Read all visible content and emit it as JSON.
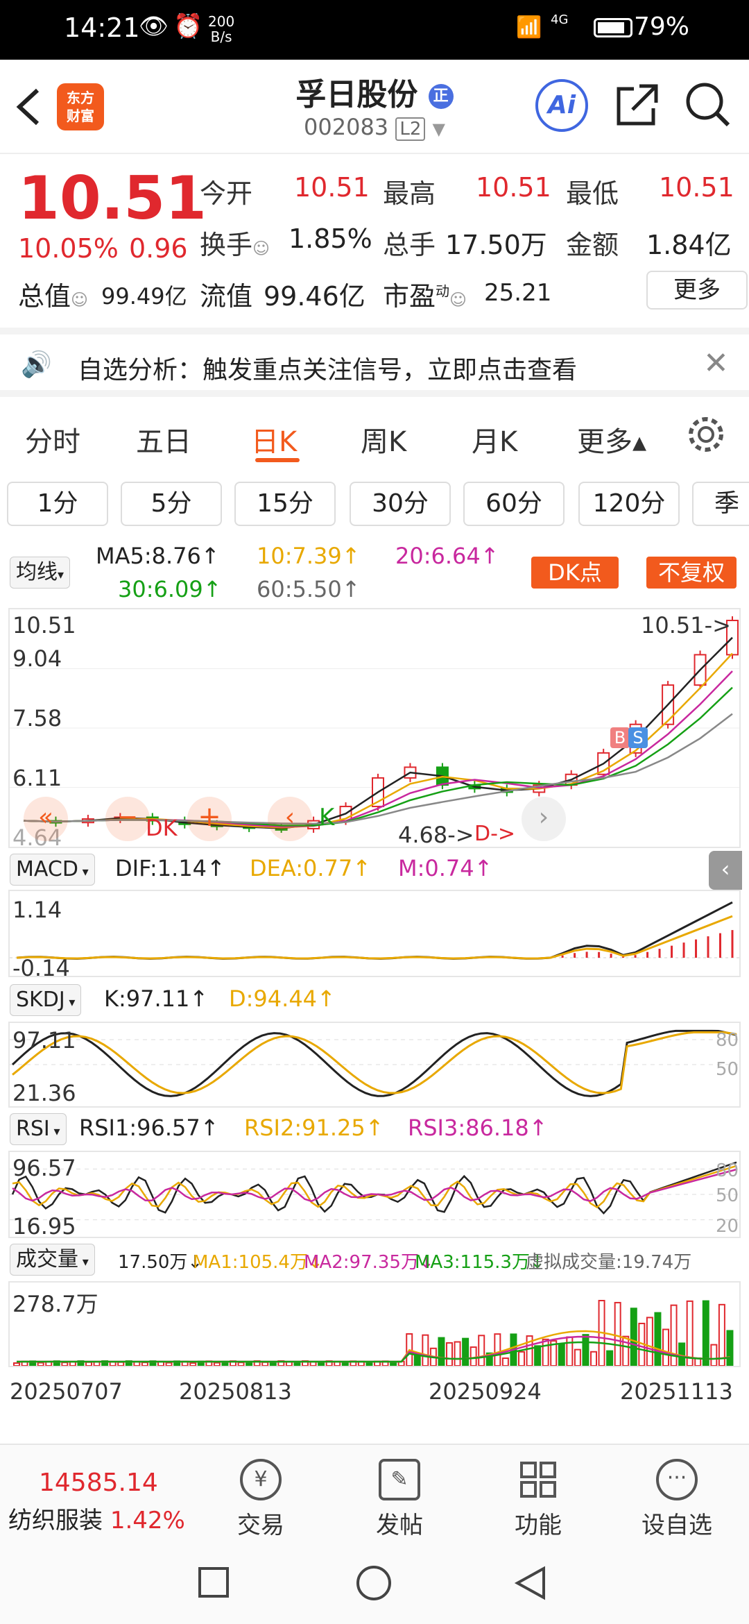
{
  "status": {
    "time": "14:21",
    "net_speed": "200",
    "net_unit": "B/s",
    "battery": "79%",
    "signal": "4G"
  },
  "header": {
    "logo_line1": "东方",
    "logo_line2": "财富",
    "name": "孚日股份",
    "badge": "正",
    "code": "002083",
    "level": "L2",
    "ai": "Ai"
  },
  "quote": {
    "price": "10.51",
    "pct": "10.05%",
    "change": "0.96",
    "rows": [
      [
        {
          "label": "今开",
          "value": "10.51",
          "red": true
        },
        {
          "label": "最高",
          "value": "10.51",
          "red": true
        },
        {
          "label": "最低",
          "value": "10.51",
          "red": true
        }
      ],
      [
        {
          "label": "换手",
          "value": "1.85%"
        },
        {
          "label": "总手",
          "value": "17.50万"
        },
        {
          "label": "金额",
          "value": "1.84亿"
        }
      ]
    ],
    "total_value_label": "总值",
    "total_value": "99.49亿",
    "float_label": "流值",
    "float_value": "99.46亿",
    "pe_label": "市盈",
    "pe_sup": "动",
    "pe_value": "25.21",
    "more": "更多"
  },
  "banner": {
    "text": "自选分析：触发重点关注信号，立即点击查看"
  },
  "tabs": [
    "分时",
    "五日",
    "日K",
    "周K",
    "月K",
    "更多▴"
  ],
  "chips": [
    "1分",
    "5分",
    "15分",
    "30分",
    "60分",
    "120分",
    "季"
  ],
  "ma": {
    "selector": "均线",
    "ma5": "MA5:8.76↑",
    "ma10": "10:7.39↑",
    "ma20": "20:6.64↑",
    "ma30": "30:6.09↑",
    "ma60": "60:5.50↑",
    "dk": "DK点",
    "fq": "不复权"
  },
  "kline": {
    "y_labels": [
      "10.51",
      "9.04",
      "7.58",
      "6.11",
      "4.64"
    ],
    "last_label": "10.51->",
    "low_label": "4.68->",
    "markers": [
      "DK",
      "K",
      "D->",
      "B",
      "S"
    ]
  },
  "macd": {
    "selector": "MACD",
    "dif": "DIF:1.14↑",
    "dea": "DEA:0.77↑",
    "m": "M:0.74↑",
    "y_top": "1.14",
    "y_bottom": "-0.14"
  },
  "skdj": {
    "selector": "SKDJ",
    "k": "K:97.11↑",
    "d": "D:94.44↑",
    "y_top": "97.11",
    "y_bottom": "21.36",
    "r80": "80",
    "r50": "50"
  },
  "rsi": {
    "selector": "RSI",
    "rsi1": "RSI1:96.57↑",
    "rsi2": "RSI2:91.25↑",
    "rsi3": "RSI3:86.18↑",
    "y_top": "96.57",
    "y_bottom": "16.95",
    "r80": "80",
    "r50": "50",
    "r20": "20"
  },
  "vol": {
    "selector": "成交量",
    "v": "17.50万↓",
    "ma1": "MA1:105.4万↓",
    "ma2": "MA2:97.35万↓",
    "ma3": "MA3:115.3万↓",
    "virt": "虚拟成交量:19.74万",
    "y_top": "278.7万"
  },
  "dates": [
    "20250707",
    "20250813",
    "20250924",
    "20251113"
  ],
  "bottom": {
    "index_value": "14585.14",
    "index_name": "纺织服装",
    "index_pct": "1.42%",
    "items": [
      "交易",
      "发帖",
      "功能",
      "设自选"
    ]
  },
  "chart_data": {
    "type": "candlestick",
    "title": "孚日股份 日K",
    "xlabel": "",
    "ylabel": "",
    "x": [
      "20250707",
      "20250813",
      "20250924",
      "20251113"
    ],
    "ylim": [
      4.64,
      10.51
    ],
    "close_trend": [
      4.9,
      4.85,
      4.95,
      5.0,
      4.9,
      4.8,
      4.75,
      4.7,
      4.68,
      4.9,
      5.3,
      6.1,
      6.4,
      5.9,
      5.8,
      5.7,
      5.9,
      6.2,
      6.8,
      7.6,
      8.7,
      9.55,
      10.51
    ],
    "ma_series": [
      {
        "name": "MA5",
        "last": 8.76
      },
      {
        "name": "MA10",
        "last": 7.39
      },
      {
        "name": "MA20",
        "last": 6.64
      },
      {
        "name": "MA30",
        "last": 6.09
      },
      {
        "name": "MA60",
        "last": 5.5
      }
    ],
    "macd": {
      "dif": 1.14,
      "dea": 0.77,
      "m": 0.74,
      "ylim": [
        -0.14,
        1.14
      ]
    },
    "skdj": {
      "k": 97.11,
      "d": 94.44,
      "ylim": [
        21.36,
        97.11
      ]
    },
    "rsi": {
      "rsi1": 96.57,
      "rsi2": 91.25,
      "rsi3": 86.18,
      "ylim": [
        16.95,
        96.57
      ]
    },
    "volume": {
      "last": "17.50万",
      "ymax": "278.7万"
    }
  }
}
